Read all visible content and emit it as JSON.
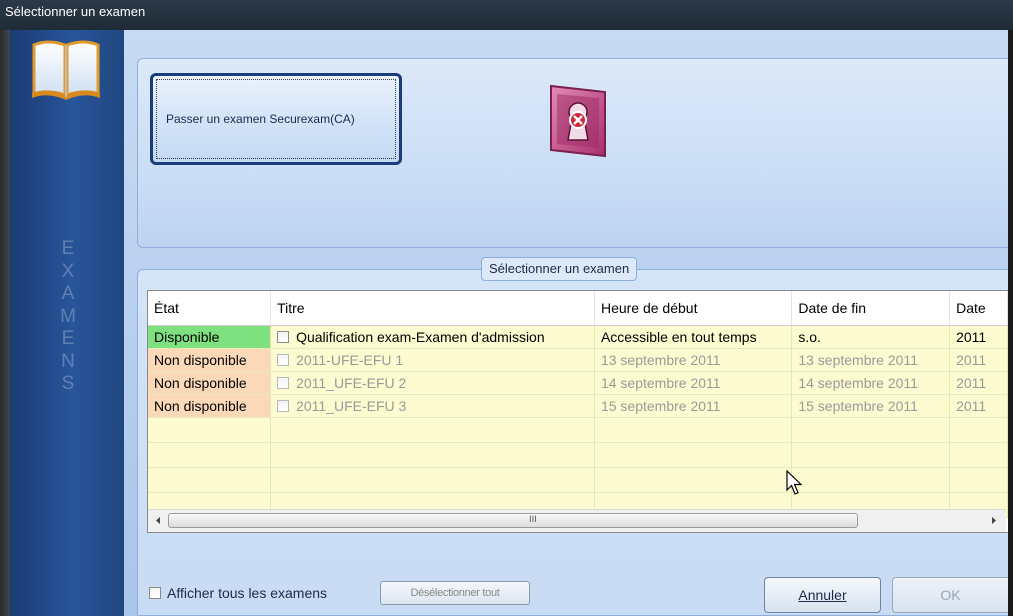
{
  "window": {
    "title": "Sélectionner un examen"
  },
  "sidebar": {
    "icon": "open-book-icon",
    "vertical_label": [
      "E",
      "X",
      "A",
      "M",
      "E",
      "N",
      "S"
    ]
  },
  "top_panel": {
    "take_exam_label": "Passer un examen Securexam(CA)",
    "lock_icon": "locked-keyhole-icon"
  },
  "exam_group": {
    "legend": "Sélectionner un examen",
    "columns": [
      "État",
      "Titre",
      "Heure de début",
      "Date de fin",
      "Date"
    ],
    "rows": [
      {
        "status": "Disponible",
        "title": "Qualification exam-Examen d'admission",
        "start": "Accessible en tout temps",
        "end": "s.o.",
        "date": "2011",
        "available": true
      },
      {
        "status": "Non disponible",
        "title": "2011-UFE-EFU 1",
        "start": "13 septembre 2011",
        "end": "13 septembre 2011",
        "date": "2011",
        "available": false
      },
      {
        "status": "Non disponible",
        "title": "2011_UFE-EFU 2",
        "start": "14 septembre 2011",
        "end": "14 septembre 2011",
        "date": "2011",
        "available": false
      },
      {
        "status": "Non disponible",
        "title": "2011_UFE-EFU 3",
        "start": "15 septembre 2011",
        "end": "15 septembre 2011",
        "date": "2011",
        "available": false
      }
    ],
    "scroll_grip": "III"
  },
  "bottom": {
    "show_all_label": "Afficher tous les examens",
    "deselect_all_label": "Désélectionner tout",
    "cancel_label": "Annuler",
    "ok_label": "OK"
  },
  "colors": {
    "available": "#7fe07f",
    "unavailable": "#fbd9b8",
    "row_bg": "#fdfbd0",
    "sidebar": "#28559a"
  }
}
